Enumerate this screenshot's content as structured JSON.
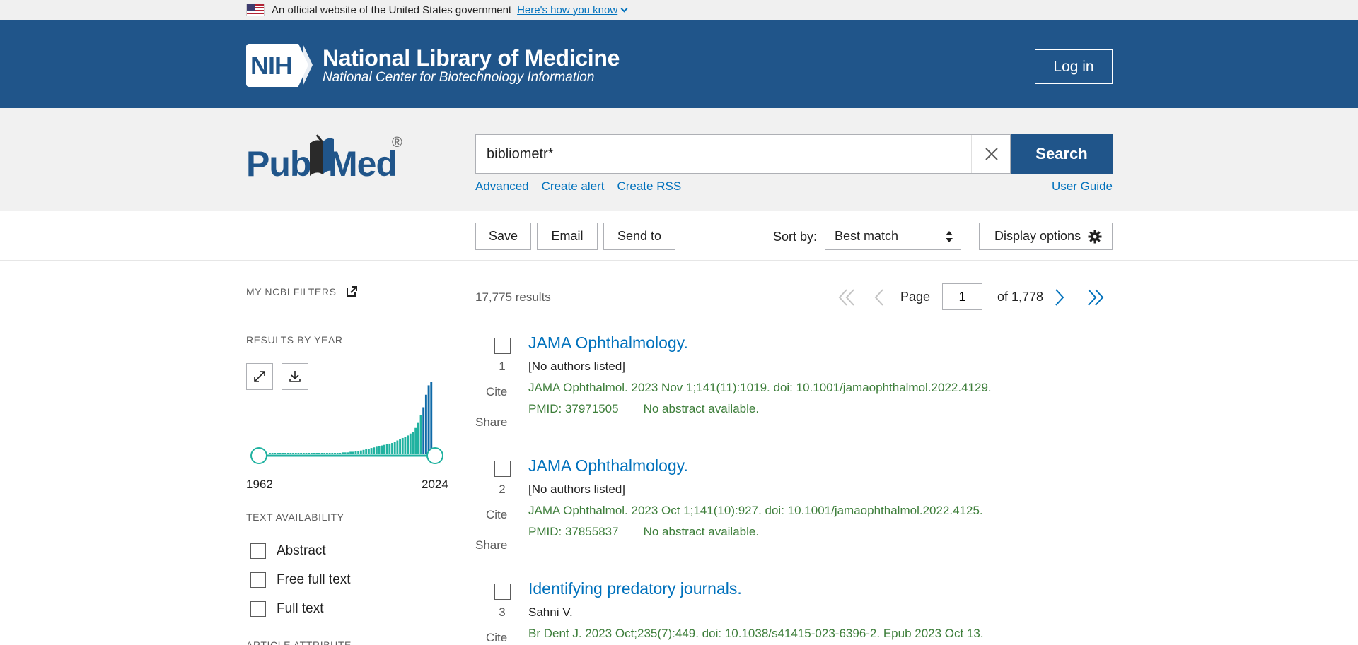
{
  "gov_banner": {
    "text": "An official website of the United States government",
    "link": "Here's how you know"
  },
  "header": {
    "logo_abbr": "NIH",
    "org_name": "National Library of Medicine",
    "org_sub": "National Center for Biotechnology Information",
    "login_label": "Log in"
  },
  "search": {
    "brand_pub": "Pub",
    "brand_med": "Med",
    "brand_reg": "®",
    "query": "bibliometr*",
    "button_label": "Search",
    "links": [
      "Advanced",
      "Create alert",
      "Create RSS"
    ],
    "user_guide": "User Guide"
  },
  "toolbar": {
    "save": "Save",
    "email": "Email",
    "send_to": "Send to",
    "sort_label": "Sort by:",
    "sort_value": "Best match",
    "display_options": "Display options"
  },
  "sidebar": {
    "my_filters": "MY NCBI FILTERS",
    "results_by_year": "RESULTS BY YEAR",
    "year_start": "1962",
    "year_end": "2024",
    "text_availability": "TEXT AVAILABILITY",
    "filters": [
      "Abstract",
      "Free full text",
      "Full text"
    ],
    "article_attribute": "ARTICLE ATTRIBUTE"
  },
  "chart_data": {
    "type": "bar",
    "x_range": [
      1962,
      2024
    ],
    "values": [
      1,
      1,
      1,
      1,
      1,
      1,
      1,
      1,
      1,
      1,
      1,
      1,
      1,
      1,
      1,
      1,
      1,
      1,
      1,
      1,
      1,
      1,
      1,
      2,
      2,
      2,
      2,
      2,
      3,
      3,
      3,
      4,
      4,
      5,
      5,
      6,
      7,
      8,
      9,
      10,
      11,
      12,
      13,
      14,
      15,
      16,
      17,
      18,
      20,
      22,
      24,
      26,
      28,
      30,
      33,
      36,
      42,
      50,
      62,
      75,
      95,
      110,
      115
    ],
    "bar_color": "#20b2a0",
    "recent_color": "#0f6aa8"
  },
  "results": {
    "count": "17,775 results",
    "page_label": "Page",
    "page_value": "1",
    "of_pages": "of 1,778",
    "items": [
      {
        "num": "1",
        "title": "JAMA Ophthalmology.",
        "authors": "[No authors listed]",
        "citation": "JAMA Ophthalmol. 2023 Nov 1;141(11):1019. doi: 10.1001/jamaophthalmol.2022.4129.",
        "pmid": "PMID: 37971505",
        "abstract": "No abstract available.",
        "cite": "Cite",
        "share": "Share"
      },
      {
        "num": "2",
        "title": "JAMA Ophthalmology.",
        "authors": "[No authors listed]",
        "citation": "JAMA Ophthalmol. 2023 Oct 1;141(10):927. doi: 10.1001/jamaophthalmol.2022.4125.",
        "pmid": "PMID: 37855837",
        "abstract": "No abstract available.",
        "cite": "Cite",
        "share": "Share"
      },
      {
        "num": "3",
        "title": "Identifying predatory journals.",
        "authors": "Sahni V.",
        "citation": "Br Dent J. 2023 Oct;235(7):449. doi: 10.1038/s41415-023-6396-2. Epub 2023 Oct 13.",
        "cite": "Cite"
      }
    ]
  },
  "colors": {
    "header_blue": "#20558a",
    "link_blue": "#0071bc",
    "citation_green": "#3d7e3a",
    "teal": "#20b2a0"
  }
}
